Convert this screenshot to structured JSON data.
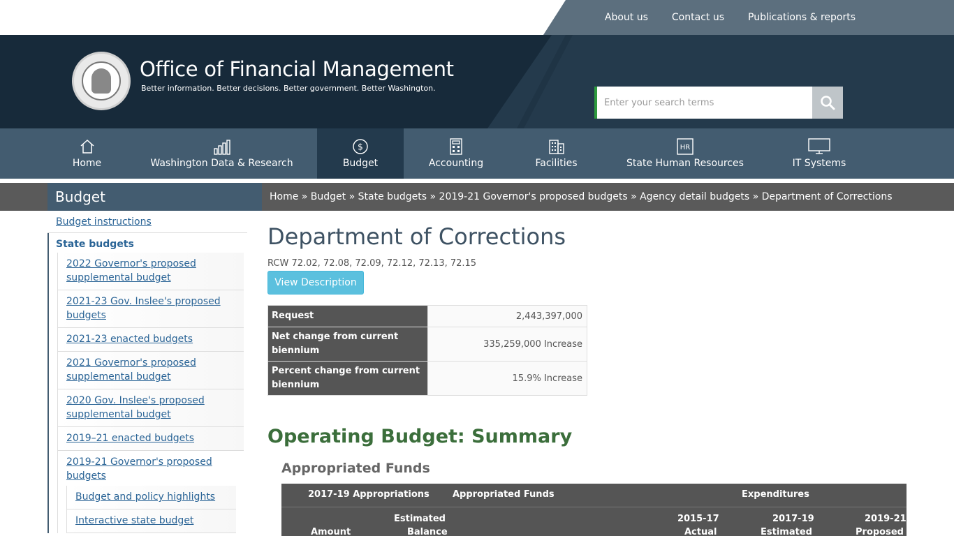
{
  "toplinks": [
    "About us",
    "Contact us",
    "Publications & reports"
  ],
  "header": {
    "title": "Office of Financial Management",
    "tagline": "Better information. Better decisions. Better government. Better Washington.",
    "search_placeholder": "Enter your search terms"
  },
  "nav": [
    {
      "label": "Home",
      "icon": "home-icon"
    },
    {
      "label": "Washington Data & Research",
      "icon": "bar-chart-icon"
    },
    {
      "label": "Budget",
      "icon": "dollar-icon"
    },
    {
      "label": "Accounting",
      "icon": "calculator-icon"
    },
    {
      "label": "Facilities",
      "icon": "building-icon"
    },
    {
      "label": "State Human Resources",
      "icon": "hr-icon"
    },
    {
      "label": "IT Systems",
      "icon": "monitor-icon"
    }
  ],
  "section": {
    "title": "Budget",
    "breadcrumb": "Home » Budget » State budgets » 2019-21 Governor's proposed budgets » Agency detail budgets » Department of Corrections"
  },
  "sidebar": {
    "top": "Budget instructions",
    "group": "State budgets",
    "items": [
      "2022 Governor's proposed supplemental budget",
      "2021-23 Gov. Inslee's proposed budgets",
      "2021-23 enacted budgets",
      "2021 Governor's proposed supplemental budget",
      "2020 Gov. Inslee's proposed supplemental budget",
      "2019–21 enacted budgets",
      "2019-21 Governor's proposed budgets"
    ],
    "subitems": [
      "Budget and policy highlights",
      "Interactive state budget"
    ]
  },
  "main": {
    "title": "Department of Corrections",
    "rcw": "RCW 72.02, 72.08, 72.09, 72.12, 72.13, 72.15",
    "button": "View Description",
    "summary": [
      {
        "label": "Request",
        "value": "2,443,397,000"
      },
      {
        "label": "Net change from current biennium",
        "value": "335,259,000 Increase"
      },
      {
        "label": "Percent change from current biennium",
        "value": "15.9% Increase"
      }
    ],
    "op_title": "Operating Budget: Summary",
    "app_title": "Appropriated Funds",
    "fund_header": {
      "col1": "2017-19 Appropriations",
      "col2": "Appropriated Funds",
      "col3": "Expenditures",
      "amount": "Amount",
      "est_balance_1": "Estimated",
      "est_balance_2": "Balance",
      "y1_1": "2015-17",
      "y1_2": "Actual",
      "y2_1": "2017-19",
      "y2_2": "Estimated",
      "y3_1": "2019-21",
      "y3_2": "Proposed"
    }
  }
}
